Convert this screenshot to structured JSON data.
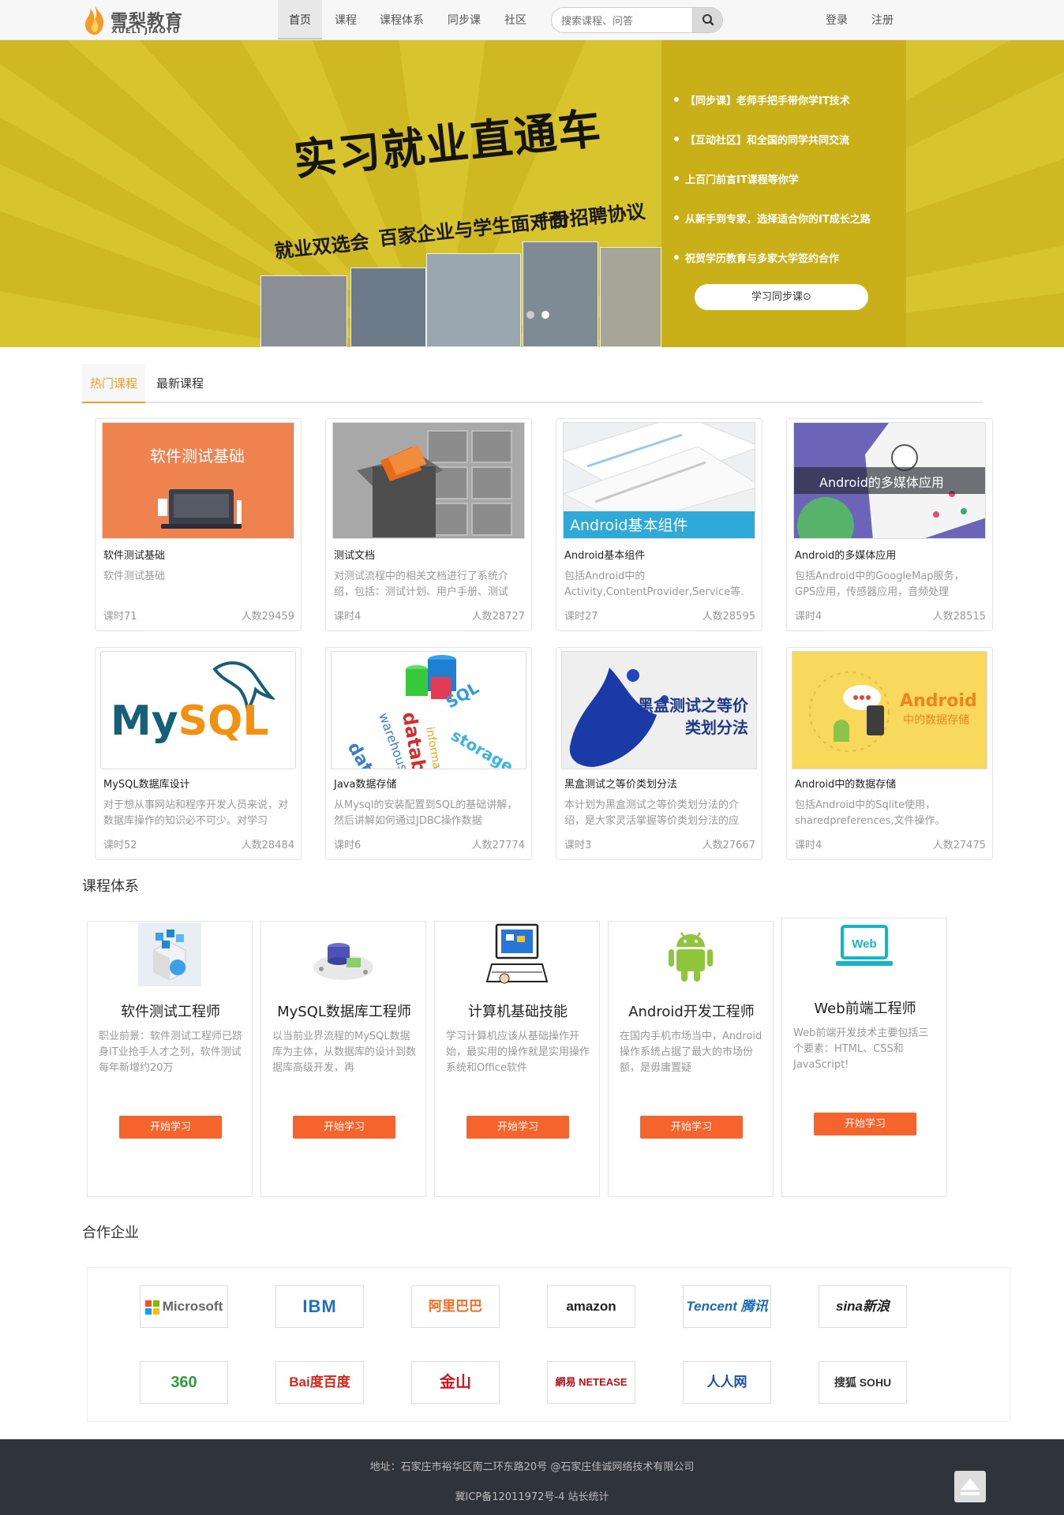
{
  "header": {
    "logo_cn": "雪梨教育",
    "logo_en": "XUELI JIAOYU",
    "nav": [
      "首页",
      "课程",
      "课程体系",
      "同步课",
      "社区"
    ],
    "search_placeholder": "搜索课程、问答",
    "login": "登录",
    "register": "注册"
  },
  "banner": {
    "slogan": "实习就业直通车",
    "sub1": "就业双选会",
    "sub2": "百家企业与学生面对面",
    "sub3": "千份招聘协议",
    "promo": [
      "【同步课】老师手把手带你学IT技术",
      "【互动社区】和全国的同学共同交流",
      "上百门前言IT课程等你学",
      "从新手到专家，选择适合你的IT成长之路",
      "祝贺学历教育与多家大学签约合作"
    ],
    "promo_button": "学习同步课⊙"
  },
  "tabs": [
    "热门课程",
    "最新课程"
  ],
  "courses": [
    {
      "title": "软件测试基础",
      "desc": "软件测试基础",
      "hours": "课时71",
      "students": "人数29459",
      "thumb_text": "软件测试基础"
    },
    {
      "title": "测试文档",
      "desc": "对测试流程中的相关文档进行了系统介绍，包括：测试计划、用户手册、测试",
      "hours": "课时4",
      "students": "人数28727",
      "thumb_text": ""
    },
    {
      "title": "Android基本组件",
      "desc": "包括Android中的Activity,ContentProvider,Service等.",
      "hours": "课时27",
      "students": "人数28595",
      "thumb_text": "Android基本组件"
    },
    {
      "title": "Android的多媒体应用",
      "desc": "包括Android中的GoogleMap服务，GPS应用，传感器应用，音频处理",
      "hours": "课时4",
      "students": "人数28515",
      "thumb_text": "Android的多媒体应用"
    },
    {
      "title": "MySQL数据库设计",
      "desc": "对于想从事网站和程序开发人员来说，对数据库操作的知识必不可少。对学习",
      "hours": "课时52",
      "students": "人数28484",
      "thumb_text": "MySQL"
    },
    {
      "title": "Java数据存储",
      "desc": "从Mysql的安装配置到SQL的基础讲解，然后讲解如何通过JDBC操作数据",
      "hours": "课时6",
      "students": "人数27774",
      "thumb_text": "database"
    },
    {
      "title": "黑盒测试之等价类划分法",
      "desc": "本计划为黑盒测试之等价类划分法的介绍，是大家灵活掌握等价类划分法的应",
      "hours": "课时3",
      "students": "人数27667",
      "thumb_text": "黑盒测试之等价类划分法"
    },
    {
      "title": "Android中的数据存储",
      "desc": "包括Android中的Sqlite使用，sharedpreferences,文件操作。",
      "hours": "课时4",
      "students": "人数27475",
      "thumb_text": "Android 中的数据存储"
    }
  ],
  "section_paths": "课程体系",
  "paths": [
    {
      "name": "软件测试工程师",
      "desc": "职业前景：软件测试工程师已跻身IT业抢手人才之列，软件测试每年新增约20万",
      "button": "开始学习"
    },
    {
      "name": "MySQL数据库工程师",
      "desc": "以当前业界流程的MySQL数据库为主体，从数据库的设计到数据库高级开发，再",
      "button": "开始学习"
    },
    {
      "name": "计算机基础技能",
      "desc": "学习计算机应该从基础操作开始，最实用的操作就是实用操作系统和Office软件",
      "button": "开始学习"
    },
    {
      "name": "Android开发工程师",
      "desc": "在国内手机市场当中，Android操作系统占据了最大的市场份额，是毋庸置疑",
      "button": "开始学习"
    },
    {
      "name": "Web前端工程师",
      "desc": "Web前端开发技术主要包括三个要素：HTML、CSS和JavaScript!",
      "button": "开始学习"
    }
  ],
  "section_partners": "合作企业",
  "partners": [
    "Microsoft",
    "IBM",
    "阿里巴巴",
    "amazon",
    "Tencent 腾讯",
    "sina新浪",
    "360",
    "Bai度百度",
    "金山",
    "網易 NETEASE",
    "人人网",
    "搜狐 SOHU"
  ],
  "footer": {
    "address": "地址：石家庄市裕华区南二环东路20号 @石家庄佳诚网络技术有限公司",
    "icp": "冀ICP备12011972号-4 站长统计"
  },
  "colors": {
    "accent": "#f39b2b",
    "button": "#f5642d",
    "banner": "#d6c128",
    "footer": "#2f333a"
  }
}
